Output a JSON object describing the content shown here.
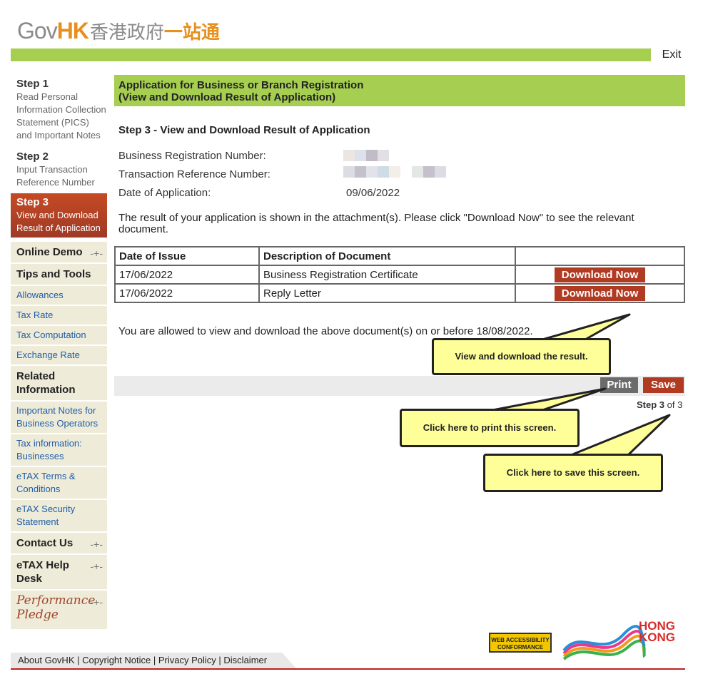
{
  "header": {
    "logo_gov": "Gov",
    "logo_hk": "HK",
    "logo_zh_gray": "香港政府",
    "logo_zh_orange": "一站通",
    "exit_label": "Exit"
  },
  "sidebar": {
    "steps": [
      {
        "title": "Step 1",
        "desc": "Read Personal Information Collection Statement (PICS) and Important Notes"
      },
      {
        "title": "Step 2",
        "desc": "Input Transaction Reference Number"
      },
      {
        "title": "Step 3",
        "desc": "View and Download Result of Application"
      }
    ],
    "online_demo": "Online Demo",
    "tips_tools": "Tips and Tools",
    "tips_links": [
      "Allowances",
      "Tax Rate",
      "Tax Computation",
      "Exchange Rate"
    ],
    "related_info": "Related Information",
    "related_links": [
      "Important Notes for Business Operators",
      "Tax information: Businesses",
      "eTAX Terms & Conditions",
      "eTAX Security Statement"
    ],
    "contact_us": "Contact Us",
    "help_desk": "eTAX Help Desk",
    "performance": "Performance",
    "pledge": "Pledge"
  },
  "main": {
    "title_line1": "Application for Business or Branch Registration",
    "title_line2": "(View and Download Result of Application)",
    "step_title": "Step 3 - View and Download Result of Application",
    "br_label": "Business Registration Number:",
    "trn_label": "Transaction Reference Number:",
    "date_label": "Date of Application:",
    "date_value": "09/06/2022",
    "note": "The result of your application is shown in the attachment(s). Please click \"Download Now\" to see the relevant document.",
    "table": {
      "headers": [
        "Date of Issue",
        "Description of Document",
        ""
      ],
      "rows": [
        {
          "date": "17/06/2022",
          "desc": "Business Registration Certificate",
          "action": "Download Now"
        },
        {
          "date": "17/06/2022",
          "desc": "Reply Letter",
          "action": "Download Now"
        }
      ]
    },
    "allowed_text": "You are allowed to view and download the above document(s) on or before 18/08/2022.",
    "print_label": "Print",
    "save_label": "Save",
    "step_of_bold": "Step 3",
    "step_of_rest": " of 3"
  },
  "callouts": {
    "view": "View and download the result.",
    "print": "Click here to print this screen.",
    "save": "Click here to save this screen."
  },
  "footer": {
    "links": [
      "About GovHK",
      "Copyright Notice",
      "Privacy Policy",
      "Disclaimer"
    ],
    "wac_line1": "WEB ACCESSIBILITY",
    "wac_line2": "CONFORMANCE",
    "brand_line1": "HONG",
    "brand_line2": "KONG"
  },
  "colors": {
    "accent_green": "#a6ce50",
    "brand_orange": "#e8901e",
    "action_red": "#b03a22",
    "callout_yellow": "#ffff99"
  }
}
